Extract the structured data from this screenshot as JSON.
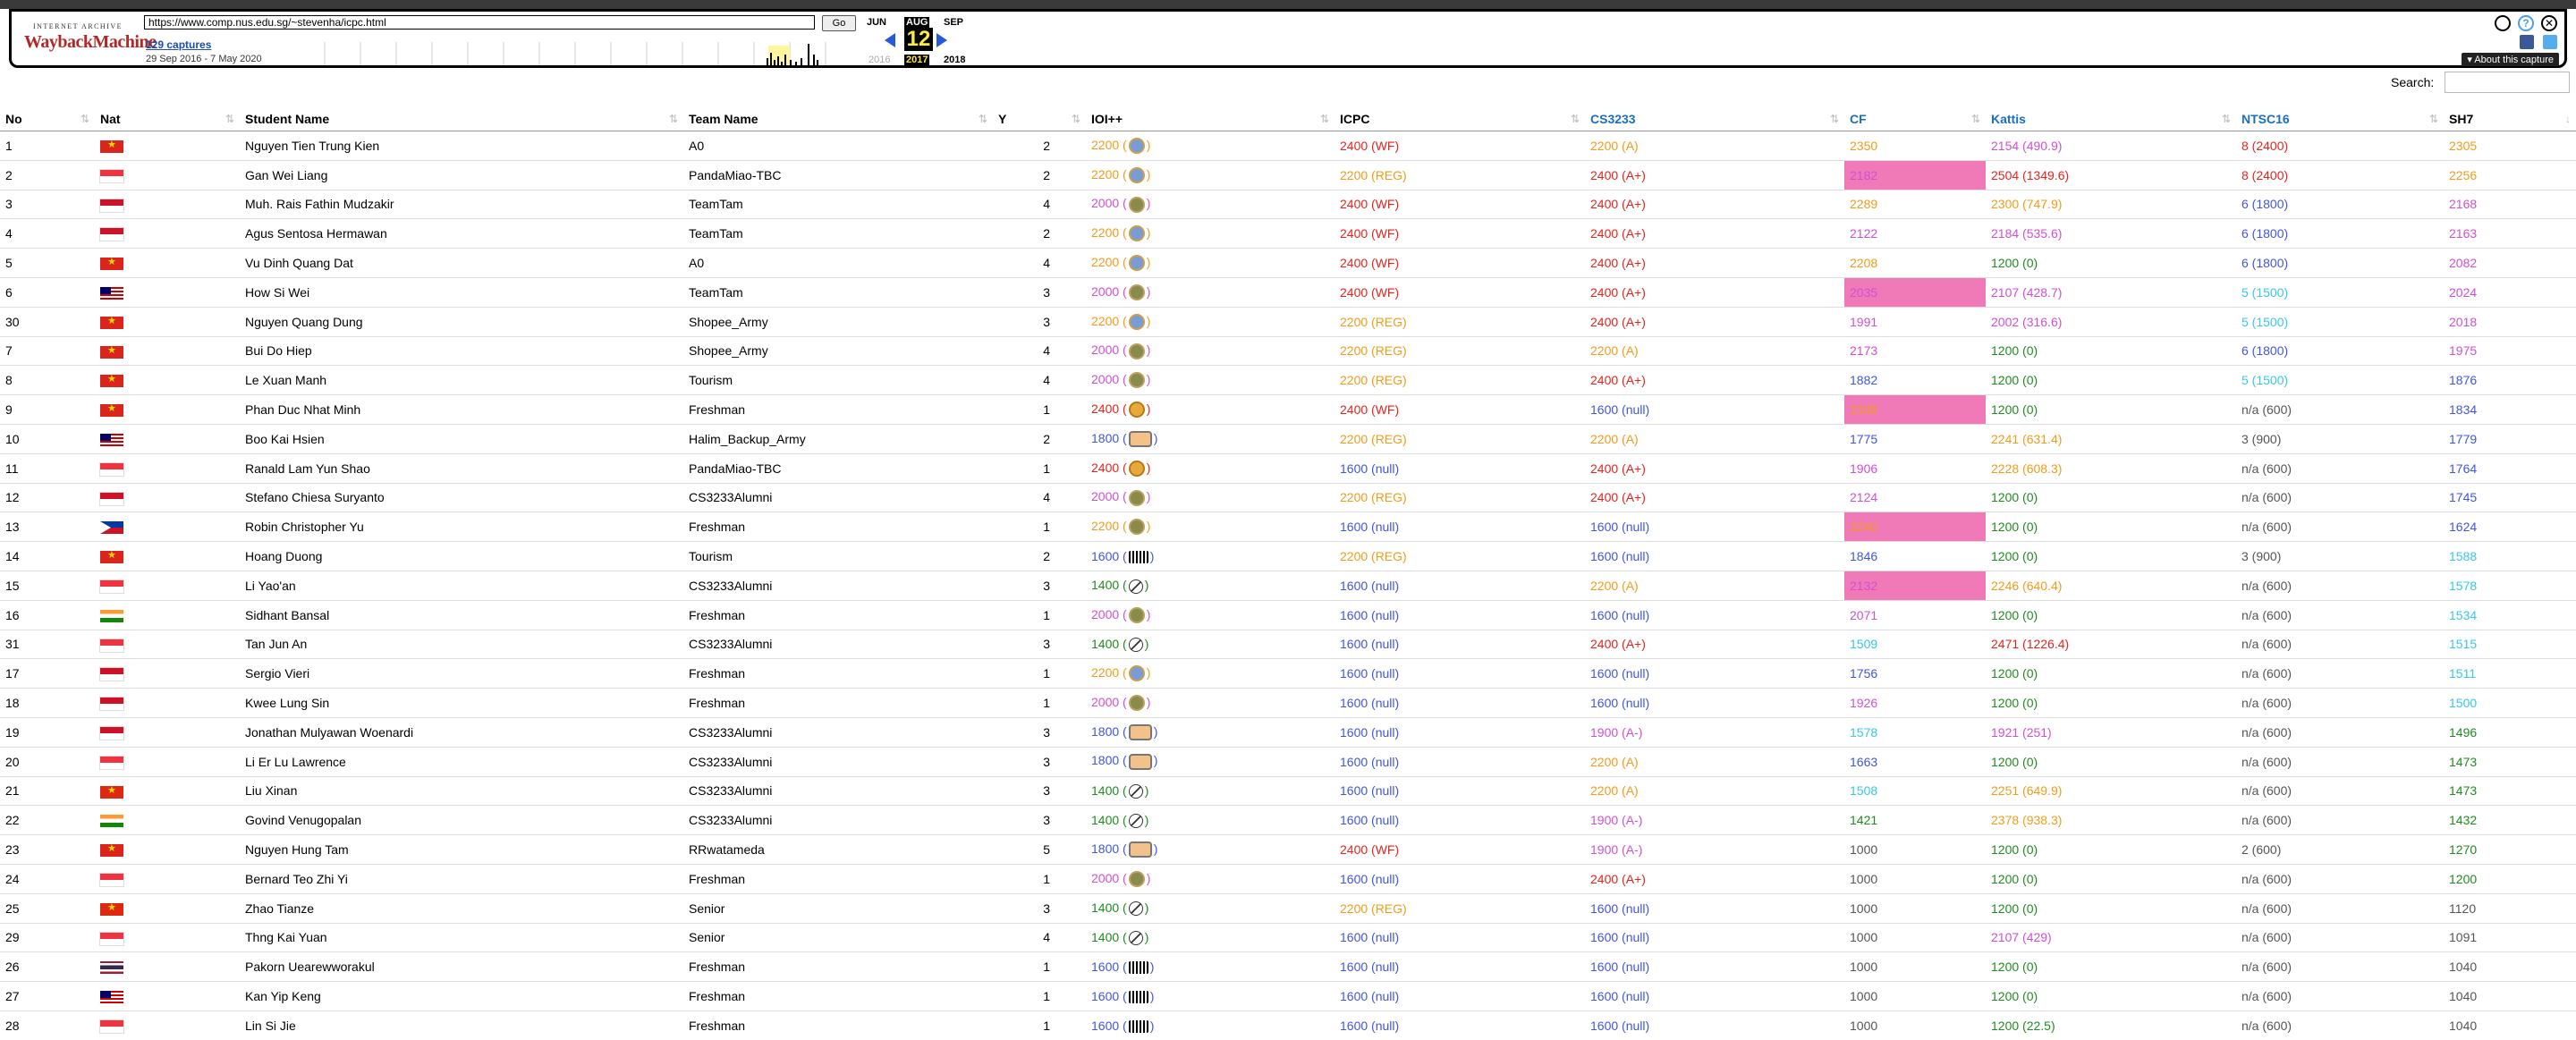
{
  "wayback": {
    "logo_top": "INTERNET ARCHIVE",
    "logo_main": "WaybackMachine",
    "url": "https://www.comp.nus.edu.sg/~stevenha/icpc.html",
    "go_label": "Go",
    "captures": "129 captures",
    "range": "29 Sep 2016 - 7 May 2020",
    "month_prev": "JUN",
    "month_cur": "AUG",
    "month_next": "SEP",
    "day": "12",
    "year_prev": "2016",
    "year_cur": "2017",
    "year_next": "2018",
    "about": "▾ About this capture"
  },
  "search_label": "Search:",
  "colors": {
    "red": "#e8231d",
    "orange": "#f39b19",
    "magenta": "#d24fd4",
    "blue": "#4055e0",
    "cyan": "#37c8e8",
    "green": "#1f8b1f",
    "gray": "#555555",
    "pink": "#f07ab8"
  },
  "columns": [
    "No",
    "Nat",
    "Student Name",
    "Team Name",
    "Y",
    "IOI++",
    "ICPC",
    "CS3233",
    "CF",
    "Kattis",
    "NTSC16",
    "SH7"
  ],
  "rows": [
    {
      "no": "1",
      "nat": "VN",
      "name": "Nguyen Tien Trung Kien",
      "team": "A0",
      "y": "2",
      "ioi": [
        "2200 (",
        ")",
        "orange",
        "blue-medal"
      ],
      "icpc": [
        "2400 (WF)",
        "red"
      ],
      "cs": [
        "2200 (A)",
        "orange"
      ],
      "cf": [
        "2350",
        "orange",
        false
      ],
      "kattis": [
        "2154 (490.9)",
        "magenta"
      ],
      "ntsc": [
        "8 (2400)",
        "red"
      ],
      "sh7": [
        "2305",
        "orange"
      ]
    },
    {
      "no": "2",
      "nat": "SG",
      "name": "Gan Wei Liang",
      "team": "PandaMiao-TBC",
      "y": "2",
      "ioi": [
        "2200 (",
        ")",
        "orange",
        "blue-medal"
      ],
      "icpc": [
        "2200 (REG)",
        "orange"
      ],
      "cs": [
        "2400 (A+)",
        "red"
      ],
      "cf": [
        "2182",
        "magenta",
        true
      ],
      "kattis": [
        "2504 (1349.6)",
        "red"
      ],
      "ntsc": [
        "8 (2400)",
        "red"
      ],
      "sh7": [
        "2256",
        "orange"
      ]
    },
    {
      "no": "3",
      "nat": "ID",
      "name": "Muh. Rais Fathin Mudzakir",
      "team": "TeamTam",
      "y": "4",
      "ioi": [
        "2000 (",
        ")",
        "magenta",
        "olive-medal"
      ],
      "icpc": [
        "2400 (WF)",
        "red"
      ],
      "cs": [
        "2400 (A+)",
        "red"
      ],
      "cf": [
        "2289",
        "orange",
        false
      ],
      "kattis": [
        "2300 (747.9)",
        "orange"
      ],
      "ntsc": [
        "6 (1800)",
        "blue"
      ],
      "sh7": [
        "2168",
        "magenta"
      ]
    },
    {
      "no": "4",
      "nat": "ID",
      "name": "Agus Sentosa Hermawan",
      "team": "TeamTam",
      "y": "2",
      "ioi": [
        "2200 (",
        ")",
        "orange",
        "blue-medal"
      ],
      "icpc": [
        "2400 (WF)",
        "red"
      ],
      "cs": [
        "2400 (A+)",
        "red"
      ],
      "cf": [
        "2122",
        "magenta",
        false
      ],
      "kattis": [
        "2184 (535.6)",
        "magenta"
      ],
      "ntsc": [
        "6 (1800)",
        "blue"
      ],
      "sh7": [
        "2163",
        "magenta"
      ]
    },
    {
      "no": "5",
      "nat": "VN",
      "name": "Vu Dinh Quang Dat",
      "team": "A0",
      "y": "4",
      "ioi": [
        "2200 (",
        ")",
        "orange",
        "blue-medal"
      ],
      "icpc": [
        "2400 (WF)",
        "red"
      ],
      "cs": [
        "2400 (A+)",
        "red"
      ],
      "cf": [
        "2208",
        "orange",
        false
      ],
      "kattis": [
        "1200 (0)",
        "green"
      ],
      "ntsc": [
        "6 (1800)",
        "blue"
      ],
      "sh7": [
        "2082",
        "magenta"
      ]
    },
    {
      "no": "6",
      "nat": "MY",
      "name": "How Si Wei",
      "team": "TeamTam",
      "y": "3",
      "ioi": [
        "2000 (",
        ")",
        "magenta",
        "olive-medal"
      ],
      "icpc": [
        "2400 (WF)",
        "red"
      ],
      "cs": [
        "2400 (A+)",
        "red"
      ],
      "cf": [
        "2035",
        "magenta",
        true
      ],
      "kattis": [
        "2107 (428.7)",
        "magenta"
      ],
      "ntsc": [
        "5 (1500)",
        "cyan"
      ],
      "sh7": [
        "2024",
        "magenta"
      ]
    },
    {
      "no": "30",
      "nat": "VN",
      "name": "Nguyen Quang Dung",
      "team": "Shopee_Army",
      "y": "3",
      "ioi": [
        "2200 (",
        ")",
        "orange",
        "blue-medal"
      ],
      "icpc": [
        "2200 (REG)",
        "orange"
      ],
      "cs": [
        "2400 (A+)",
        "red"
      ],
      "cf": [
        "1991",
        "magenta",
        false
      ],
      "kattis": [
        "2002 (316.6)",
        "magenta"
      ],
      "ntsc": [
        "5 (1500)",
        "cyan"
      ],
      "sh7": [
        "2018",
        "magenta"
      ]
    },
    {
      "no": "7",
      "nat": "VN",
      "name": "Bui Do Hiep",
      "team": "Shopee_Army",
      "y": "4",
      "ioi": [
        "2000 (",
        ")",
        "magenta",
        "olive-medal"
      ],
      "icpc": [
        "2200 (REG)",
        "orange"
      ],
      "cs": [
        "2200 (A)",
        "orange"
      ],
      "cf": [
        "2173",
        "magenta",
        false
      ],
      "kattis": [
        "1200 (0)",
        "green"
      ],
      "ntsc": [
        "6 (1800)",
        "blue"
      ],
      "sh7": [
        "1975",
        "magenta"
      ]
    },
    {
      "no": "8",
      "nat": "VN",
      "name": "Le Xuan Manh",
      "team": "Tourism",
      "y": "4",
      "ioi": [
        "2000 (",
        ")",
        "magenta",
        "olive-medal"
      ],
      "icpc": [
        "2200 (REG)",
        "orange"
      ],
      "cs": [
        "2400 (A+)",
        "red"
      ],
      "cf": [
        "1882",
        "blue",
        false
      ],
      "kattis": [
        "1200 (0)",
        "green"
      ],
      "ntsc": [
        "5 (1500)",
        "cyan"
      ],
      "sh7": [
        "1876",
        "blue"
      ]
    },
    {
      "no": "9",
      "nat": "VN",
      "name": "Phan Duc Nhat Minh",
      "team": "Freshman",
      "y": "1",
      "ioi": [
        "2400 (",
        ")",
        "red",
        "gold-medal"
      ],
      "icpc": [
        "2400 (WF)",
        "red"
      ],
      "cs": [
        "1600 (null)",
        "blue"
      ],
      "cf": [
        "2336",
        "orange",
        true
      ],
      "kattis": [
        "1200 (0)",
        "green"
      ],
      "ntsc": [
        "n/a (600)",
        "gray"
      ],
      "sh7": [
        "1834",
        "blue"
      ]
    },
    {
      "no": "10",
      "nat": "MY",
      "name": "Boo Kai Hsien",
      "team": "Halim_Backup_Army",
      "y": "2",
      "ioi": [
        "1800 (",
        ")",
        "blue",
        "hm-medal"
      ],
      "icpc": [
        "2200 (REG)",
        "orange"
      ],
      "cs": [
        "2200 (A)",
        "orange"
      ],
      "cf": [
        "1775",
        "blue",
        false
      ],
      "kattis": [
        "2241 (631.4)",
        "orange"
      ],
      "ntsc": [
        "3 (900)",
        "gray"
      ],
      "sh7": [
        "1779",
        "blue"
      ]
    },
    {
      "no": "11",
      "nat": "SG",
      "name": "Ranald Lam Yun Shao",
      "team": "PandaMiao-TBC",
      "y": "1",
      "ioi": [
        "2400 (",
        ")",
        "red",
        "gold-medal"
      ],
      "icpc": [
        "1600 (null)",
        "blue"
      ],
      "cs": [
        "2400 (A+)",
        "red"
      ],
      "cf": [
        "1906",
        "magenta",
        false
      ],
      "kattis": [
        "2228 (608.3)",
        "orange"
      ],
      "ntsc": [
        "n/a (600)",
        "gray"
      ],
      "sh7": [
        "1764",
        "blue"
      ]
    },
    {
      "no": "12",
      "nat": "ID",
      "name": "Stefano Chiesa Suryanto",
      "team": "CS3233Alumni",
      "y": "4",
      "ioi": [
        "2000 (",
        ")",
        "magenta",
        "olive-medal"
      ],
      "icpc": [
        "2200 (REG)",
        "orange"
      ],
      "cs": [
        "2400 (A+)",
        "red"
      ],
      "cf": [
        "2124",
        "magenta",
        false
      ],
      "kattis": [
        "1200 (0)",
        "green"
      ],
      "ntsc": [
        "n/a (600)",
        "gray"
      ],
      "sh7": [
        "1745",
        "blue"
      ]
    },
    {
      "no": "13",
      "nat": "PH",
      "name": "Robin Christopher Yu",
      "team": "Freshman",
      "y": "1",
      "ioi": [
        "2200 (",
        ")",
        "orange",
        "olive-medal"
      ],
      "icpc": [
        "1600 (null)",
        "blue"
      ],
      "cs": [
        "1600 (null)",
        "blue"
      ],
      "cf": [
        "2240",
        "orange",
        true
      ],
      "kattis": [
        "1200 (0)",
        "green"
      ],
      "ntsc": [
        "n/a (600)",
        "gray"
      ],
      "sh7": [
        "1624",
        "blue"
      ]
    },
    {
      "no": "14",
      "nat": "VN",
      "name": "Hoang Duong",
      "team": "Tourism",
      "y": "2",
      "ioi": [
        "1600 (",
        ")",
        "blue",
        "null-medal"
      ],
      "icpc": [
        "2200 (REG)",
        "orange"
      ],
      "cs": [
        "1600 (null)",
        "blue"
      ],
      "cf": [
        "1846",
        "blue",
        false
      ],
      "kattis": [
        "1200 (0)",
        "green"
      ],
      "ntsc": [
        "3 (900)",
        "gray"
      ],
      "sh7": [
        "1588",
        "cyan"
      ]
    },
    {
      "no": "15",
      "nat": "SG",
      "name": "Li Yao'an",
      "team": "CS3233Alumni",
      "y": "3",
      "ioi": [
        "1400 (",
        ")",
        "green",
        "empty-medal"
      ],
      "icpc": [
        "1600 (null)",
        "blue"
      ],
      "cs": [
        "2200 (A)",
        "orange"
      ],
      "cf": [
        "2132",
        "magenta",
        true
      ],
      "kattis": [
        "2246 (640.4)",
        "orange"
      ],
      "ntsc": [
        "n/a (600)",
        "gray"
      ],
      "sh7": [
        "1578",
        "cyan"
      ]
    },
    {
      "no": "16",
      "nat": "IN",
      "name": "Sidhant Bansal",
      "team": "Freshman",
      "y": "1",
      "ioi": [
        "2000 (",
        ")",
        "magenta",
        "olive-medal"
      ],
      "icpc": [
        "1600 (null)",
        "blue"
      ],
      "cs": [
        "1600 (null)",
        "blue"
      ],
      "cf": [
        "2071",
        "magenta",
        false
      ],
      "kattis": [
        "1200 (0)",
        "green"
      ],
      "ntsc": [
        "n/a (600)",
        "gray"
      ],
      "sh7": [
        "1534",
        "cyan"
      ]
    },
    {
      "no": "31",
      "nat": "SG",
      "name": "Tan Jun An",
      "team": "CS3233Alumni",
      "y": "3",
      "ioi": [
        "1400 (",
        ")",
        "green",
        "empty-medal"
      ],
      "icpc": [
        "1600 (null)",
        "blue"
      ],
      "cs": [
        "2400 (A+)",
        "red"
      ],
      "cf": [
        "1509",
        "cyan",
        false
      ],
      "kattis": [
        "2471 (1226.4)",
        "red"
      ],
      "ntsc": [
        "n/a (600)",
        "gray"
      ],
      "sh7": [
        "1515",
        "cyan"
      ]
    },
    {
      "no": "17",
      "nat": "ID",
      "name": "Sergio Vieri",
      "team": "Freshman",
      "y": "1",
      "ioi": [
        "2200 (",
        ")",
        "orange",
        "blue-medal"
      ],
      "icpc": [
        "1600 (null)",
        "blue"
      ],
      "cs": [
        "1600 (null)",
        "blue"
      ],
      "cf": [
        "1756",
        "blue",
        false
      ],
      "kattis": [
        "1200 (0)",
        "green"
      ],
      "ntsc": [
        "n/a (600)",
        "gray"
      ],
      "sh7": [
        "1511",
        "cyan"
      ]
    },
    {
      "no": "18",
      "nat": "ID",
      "name": "Kwee Lung Sin",
      "team": "Freshman",
      "y": "1",
      "ioi": [
        "2000 (",
        ")",
        "magenta",
        "olive-medal"
      ],
      "icpc": [
        "1600 (null)",
        "blue"
      ],
      "cs": [
        "1600 (null)",
        "blue"
      ],
      "cf": [
        "1926",
        "magenta",
        false
      ],
      "kattis": [
        "1200 (0)",
        "green"
      ],
      "ntsc": [
        "n/a (600)",
        "gray"
      ],
      "sh7": [
        "1500",
        "cyan"
      ]
    },
    {
      "no": "19",
      "nat": "ID",
      "name": "Jonathan Mulyawan Woenardi",
      "team": "CS3233Alumni",
      "y": "3",
      "ioi": [
        "1800 (",
        ")",
        "blue",
        "hm-medal"
      ],
      "icpc": [
        "1600 (null)",
        "blue"
      ],
      "cs": [
        "1900 (A-)",
        "magenta"
      ],
      "cf": [
        "1578",
        "cyan",
        false
      ],
      "kattis": [
        "1921 (251)",
        "magenta"
      ],
      "ntsc": [
        "n/a (600)",
        "gray"
      ],
      "sh7": [
        "1496",
        "green"
      ]
    },
    {
      "no": "20",
      "nat": "SG",
      "name": "Li Er Lu Lawrence",
      "team": "CS3233Alumni",
      "y": "3",
      "ioi": [
        "1800 (",
        ")",
        "blue",
        "hm-medal"
      ],
      "icpc": [
        "1600 (null)",
        "blue"
      ],
      "cs": [
        "2200 (A)",
        "orange"
      ],
      "cf": [
        "1663",
        "blue",
        false
      ],
      "kattis": [
        "1200 (0)",
        "green"
      ],
      "ntsc": [
        "n/a (600)",
        "gray"
      ],
      "sh7": [
        "1473",
        "green"
      ]
    },
    {
      "no": "21",
      "nat": "CN",
      "name": "Liu Xinan",
      "team": "CS3233Alumni",
      "y": "3",
      "ioi": [
        "1400 (",
        ")",
        "green",
        "empty-medal"
      ],
      "icpc": [
        "1600 (null)",
        "blue"
      ],
      "cs": [
        "2200 (A)",
        "orange"
      ],
      "cf": [
        "1508",
        "cyan",
        false
      ],
      "kattis": [
        "2251 (649.9)",
        "orange"
      ],
      "ntsc": [
        "n/a (600)",
        "gray"
      ],
      "sh7": [
        "1473",
        "green"
      ]
    },
    {
      "no": "22",
      "nat": "IN",
      "name": "Govind Venugopalan",
      "team": "CS3233Alumni",
      "y": "3",
      "ioi": [
        "1400 (",
        ")",
        "green",
        "empty-medal"
      ],
      "icpc": [
        "1600 (null)",
        "blue"
      ],
      "cs": [
        "1900 (A-)",
        "magenta"
      ],
      "cf": [
        "1421",
        "green",
        false
      ],
      "kattis": [
        "2378 (938.3)",
        "orange"
      ],
      "ntsc": [
        "n/a (600)",
        "gray"
      ],
      "sh7": [
        "1432",
        "green"
      ]
    },
    {
      "no": "23",
      "nat": "VN",
      "name": "Nguyen Hung Tam",
      "team": "RRwatameda",
      "y": "5",
      "ioi": [
        "1800 (",
        ")",
        "blue",
        "hm-medal"
      ],
      "icpc": [
        "2400 (WF)",
        "red"
      ],
      "cs": [
        "1900 (A-)",
        "magenta"
      ],
      "cf": [
        "1000",
        "gray",
        false
      ],
      "kattis": [
        "1200 (0)",
        "green"
      ],
      "ntsc": [
        "2 (600)",
        "gray"
      ],
      "sh7": [
        "1270",
        "green"
      ]
    },
    {
      "no": "24",
      "nat": "SG",
      "name": "Bernard Teo Zhi Yi",
      "team": "Freshman",
      "y": "1",
      "ioi": [
        "2000 (",
        ")",
        "magenta",
        "olive-medal"
      ],
      "icpc": [
        "1600 (null)",
        "blue"
      ],
      "cs": [
        "2400 (A+)",
        "red"
      ],
      "cf": [
        "1000",
        "gray",
        false
      ],
      "kattis": [
        "1200 (0)",
        "green"
      ],
      "ntsc": [
        "n/a (600)",
        "gray"
      ],
      "sh7": [
        "1200",
        "green"
      ]
    },
    {
      "no": "25",
      "nat": "CN",
      "name": "Zhao Tianze",
      "team": "Senior",
      "y": "3",
      "ioi": [
        "1400 (",
        ")",
        "green",
        "empty-medal"
      ],
      "icpc": [
        "2200 (REG)",
        "orange"
      ],
      "cs": [
        "1600 (null)",
        "blue"
      ],
      "cf": [
        "1000",
        "gray",
        false
      ],
      "kattis": [
        "1200 (0)",
        "green"
      ],
      "ntsc": [
        "n/a (600)",
        "gray"
      ],
      "sh7": [
        "1120",
        "gray"
      ]
    },
    {
      "no": "29",
      "nat": "SG",
      "name": "Thng Kai Yuan",
      "team": "Senior",
      "y": "4",
      "ioi": [
        "1400 (",
        ")",
        "green",
        "empty-medal"
      ],
      "icpc": [
        "1600 (null)",
        "blue"
      ],
      "cs": [
        "1600 (null)",
        "blue"
      ],
      "cf": [
        "1000",
        "gray",
        false
      ],
      "kattis": [
        "2107 (429)",
        "magenta"
      ],
      "ntsc": [
        "n/a (600)",
        "gray"
      ],
      "sh7": [
        "1091",
        "gray"
      ]
    },
    {
      "no": "26",
      "nat": "TH",
      "name": "Pakorn Uearewworakul",
      "team": "Freshman",
      "y": "1",
      "ioi": [
        "1600 (",
        ")",
        "blue",
        "null-medal"
      ],
      "icpc": [
        "1600 (null)",
        "blue"
      ],
      "cs": [
        "1600 (null)",
        "blue"
      ],
      "cf": [
        "1000",
        "gray",
        false
      ],
      "kattis": [
        "1200 (0)",
        "green"
      ],
      "ntsc": [
        "n/a (600)",
        "gray"
      ],
      "sh7": [
        "1040",
        "gray"
      ]
    },
    {
      "no": "27",
      "nat": "MY",
      "name": "Kan Yip Keng",
      "team": "Freshman",
      "y": "1",
      "ioi": [
        "1600 (",
        ")",
        "blue",
        "null-medal"
      ],
      "icpc": [
        "1600 (null)",
        "blue"
      ],
      "cs": [
        "1600 (null)",
        "blue"
      ],
      "cf": [
        "1000",
        "gray",
        false
      ],
      "kattis": [
        "1200 (0)",
        "green"
      ],
      "ntsc": [
        "n/a (600)",
        "gray"
      ],
      "sh7": [
        "1040",
        "gray"
      ]
    },
    {
      "no": "28",
      "nat": "SG",
      "name": "Lin Si Jie",
      "team": "Freshman",
      "y": "1",
      "ioi": [
        "1600 (",
        ")",
        "blue",
        "null-medal"
      ],
      "icpc": [
        "1600 (null)",
        "blue"
      ],
      "cs": [
        "1600 (null)",
        "blue"
      ],
      "cf": [
        "1000",
        "gray",
        false
      ],
      "kattis": [
        "1200 (22.5)",
        "green"
      ],
      "ntsc": [
        "n/a (600)",
        "gray"
      ],
      "sh7": [
        "1040",
        "gray"
      ]
    }
  ]
}
